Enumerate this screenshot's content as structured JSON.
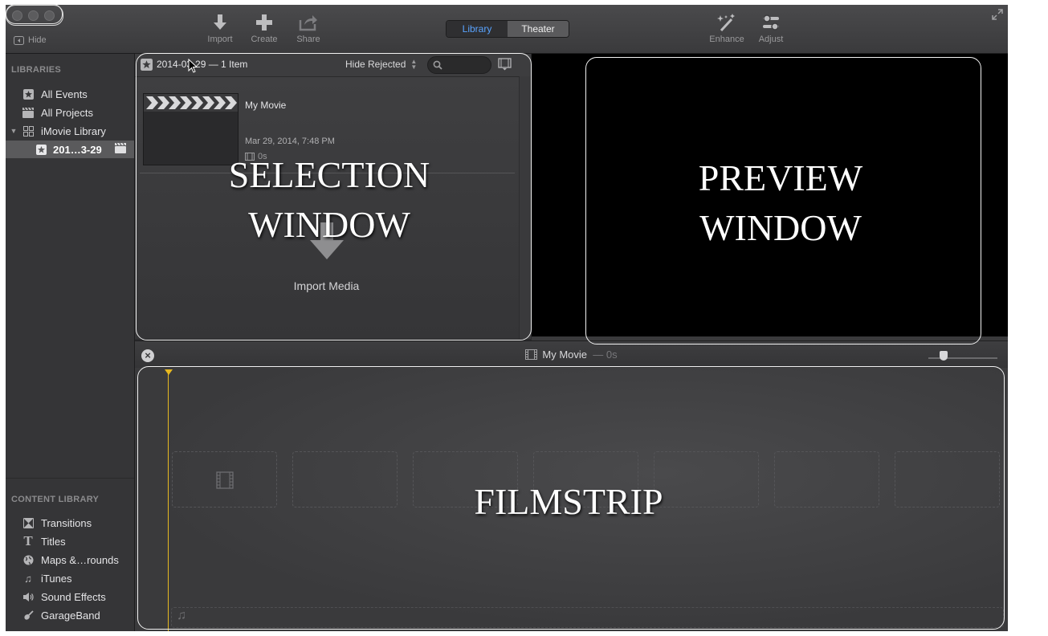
{
  "window": {
    "traffic_lights": [
      "close",
      "minimize",
      "zoom"
    ]
  },
  "toolbar": {
    "hide_label": "Hide",
    "import_label": "Import",
    "create_label": "Create",
    "share_label": "Share",
    "enhance_label": "Enhance",
    "adjust_label": "Adjust",
    "segments": {
      "library": "Library",
      "theater": "Theater"
    },
    "active_segment": "Library"
  },
  "sidebar": {
    "libraries_header": "LIBRARIES",
    "items": [
      {
        "label": "All Events",
        "icon": "star-icon"
      },
      {
        "label": "All Projects",
        "icon": "clapper-icon"
      },
      {
        "label": "iMovie Library",
        "icon": "grid-icon"
      },
      {
        "label": "201…3-29",
        "icon": "star-icon",
        "selected": true
      }
    ],
    "content_header": "CONTENT LIBRARY",
    "content_items": [
      {
        "label": "Transitions",
        "icon": "transitions-icon"
      },
      {
        "label": "Titles",
        "icon": "titles-icon"
      },
      {
        "label": "Maps &…rounds",
        "icon": "globe-icon"
      },
      {
        "label": "iTunes",
        "icon": "music-note-icon"
      },
      {
        "label": "Sound Effects",
        "icon": "speaker-icon"
      },
      {
        "label": "GarageBand",
        "icon": "guitar-icon"
      }
    ]
  },
  "browser": {
    "event_title": "2014-03-29 — 1 Item",
    "hide_rejected": "Hide Rejected",
    "clip": {
      "title": "My Movie",
      "date": "Mar 29, 2014, 7:48 PM",
      "duration": "0s"
    },
    "import_media": "Import Media"
  },
  "timeline": {
    "title": "My Movie",
    "duration": "— 0s"
  },
  "annotations": {
    "selection_line1": "SELECTION",
    "selection_line2": "WINDOW",
    "preview_line1": "PREVIEW",
    "preview_line2": "WINDOW",
    "filmstrip": "FILMSTRIP"
  },
  "colors": {
    "accent": "#59a3ff",
    "playhead": "#e6b820",
    "background": "#2b2b2d"
  }
}
